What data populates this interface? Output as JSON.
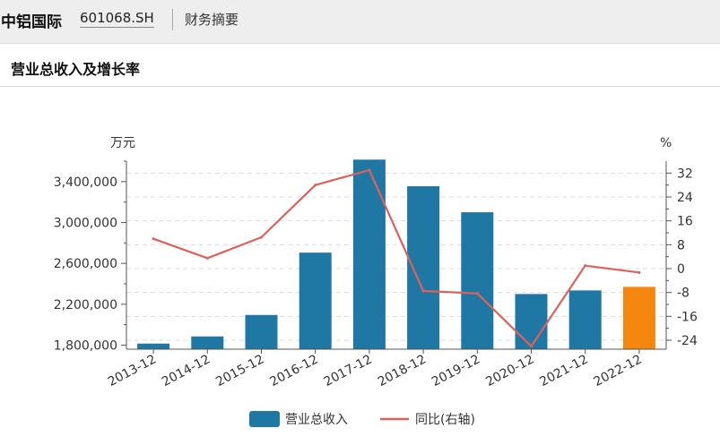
{
  "header": {
    "company_name": "中铝国际",
    "stock_code": "601068.SH",
    "section_label": "财务摘要"
  },
  "subheader": {
    "title": "营业总收入及增长率"
  },
  "chart_data": {
    "type": "bar",
    "categories": [
      "2013-12",
      "2014-12",
      "2015-12",
      "2016-12",
      "2017-12",
      "2018-12",
      "2019-12",
      "2020-12",
      "2021-12",
      "2022-12"
    ],
    "series": [
      {
        "name": "营业总收入",
        "type": "bar",
        "axis": "left",
        "values": [
          1815000,
          1885000,
          2095000,
          2705000,
          3615000,
          3355000,
          3100000,
          2300000,
          2335000,
          2370000
        ],
        "colors": [
          "#1f77a4",
          "#1f77a4",
          "#1f77a4",
          "#1f77a4",
          "#1f77a4",
          "#1f77a4",
          "#1f77a4",
          "#1f77a4",
          "#1f77a4",
          "#f5870f"
        ]
      },
      {
        "name": "同比(右轴)",
        "type": "line",
        "axis": "right",
        "values": [
          10,
          3.5,
          10.5,
          28,
          33,
          -7.5,
          -8.3,
          -26,
          1,
          -1.3
        ],
        "color": "#e0605a"
      }
    ],
    "y_left": {
      "unit_label": "万元",
      "ticks": [
        1800000,
        2200000,
        2600000,
        3000000,
        3400000
      ],
      "tick_labels": [
        "1,800,000",
        "2,200,000",
        "2,600,000",
        "3,000,000",
        "3,400,000"
      ],
      "range": [
        1760000,
        3600000
      ]
    },
    "y_right": {
      "unit_label": "%",
      "ticks": [
        -24,
        -16,
        -8,
        0,
        8,
        16,
        24,
        32
      ],
      "tick_labels": [
        "-24",
        "-16",
        "-8",
        "0",
        "8",
        "16",
        "24",
        "32"
      ],
      "range": [
        -27,
        36
      ]
    },
    "grid": true,
    "legend_position": "bottom"
  }
}
